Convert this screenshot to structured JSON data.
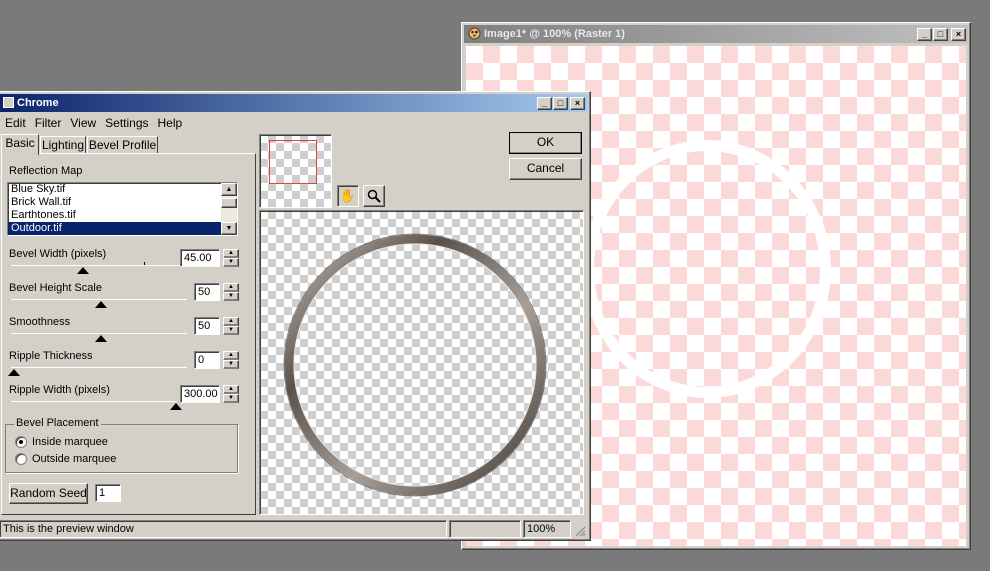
{
  "image_window": {
    "title": "Image1* @ 100% (Raster 1)",
    "controls": {
      "minimize": "_",
      "maximize": "□",
      "close": "×"
    }
  },
  "dialog": {
    "title": "Chrome",
    "controls": {
      "minimize": "_",
      "maximize": "□",
      "close": "×"
    },
    "menu": [
      "Edit",
      "Filter",
      "View",
      "Settings",
      "Help"
    ],
    "tabs": [
      "Basic",
      "Lighting",
      "Bevel Profile"
    ],
    "active_tab": "Basic",
    "reflection_map": {
      "label": "Reflection Map",
      "items": [
        "Blue Sky.tif",
        "Brick Wall.tif",
        "Earthtones.tif",
        "Outdoor.tif"
      ],
      "selected": "Outdoor.tif"
    },
    "sliders": [
      {
        "label": "Bevel Width (pixels)",
        "value": "45.00",
        "position": 0.3
      },
      {
        "label": "Bevel Height Scale",
        "value": "50",
        "position": 0.5
      },
      {
        "label": "Smoothness",
        "value": "50",
        "position": 0.5
      },
      {
        "label": "Ripple Thickness",
        "value": "0",
        "position": 0.0
      },
      {
        "label": "Ripple Width (pixels)",
        "value": "300.00",
        "position": 1.0
      }
    ],
    "bevel_placement": {
      "label": "Bevel Placement",
      "options": [
        "Inside marquee",
        "Outside marquee"
      ],
      "selected": "Inside marquee"
    },
    "random_seed": {
      "label": "Random Seed",
      "value": "1"
    },
    "buttons": {
      "ok": "OK",
      "cancel": "Cancel"
    },
    "status": {
      "message": "This is the preview window",
      "zoom": "100%"
    }
  }
}
